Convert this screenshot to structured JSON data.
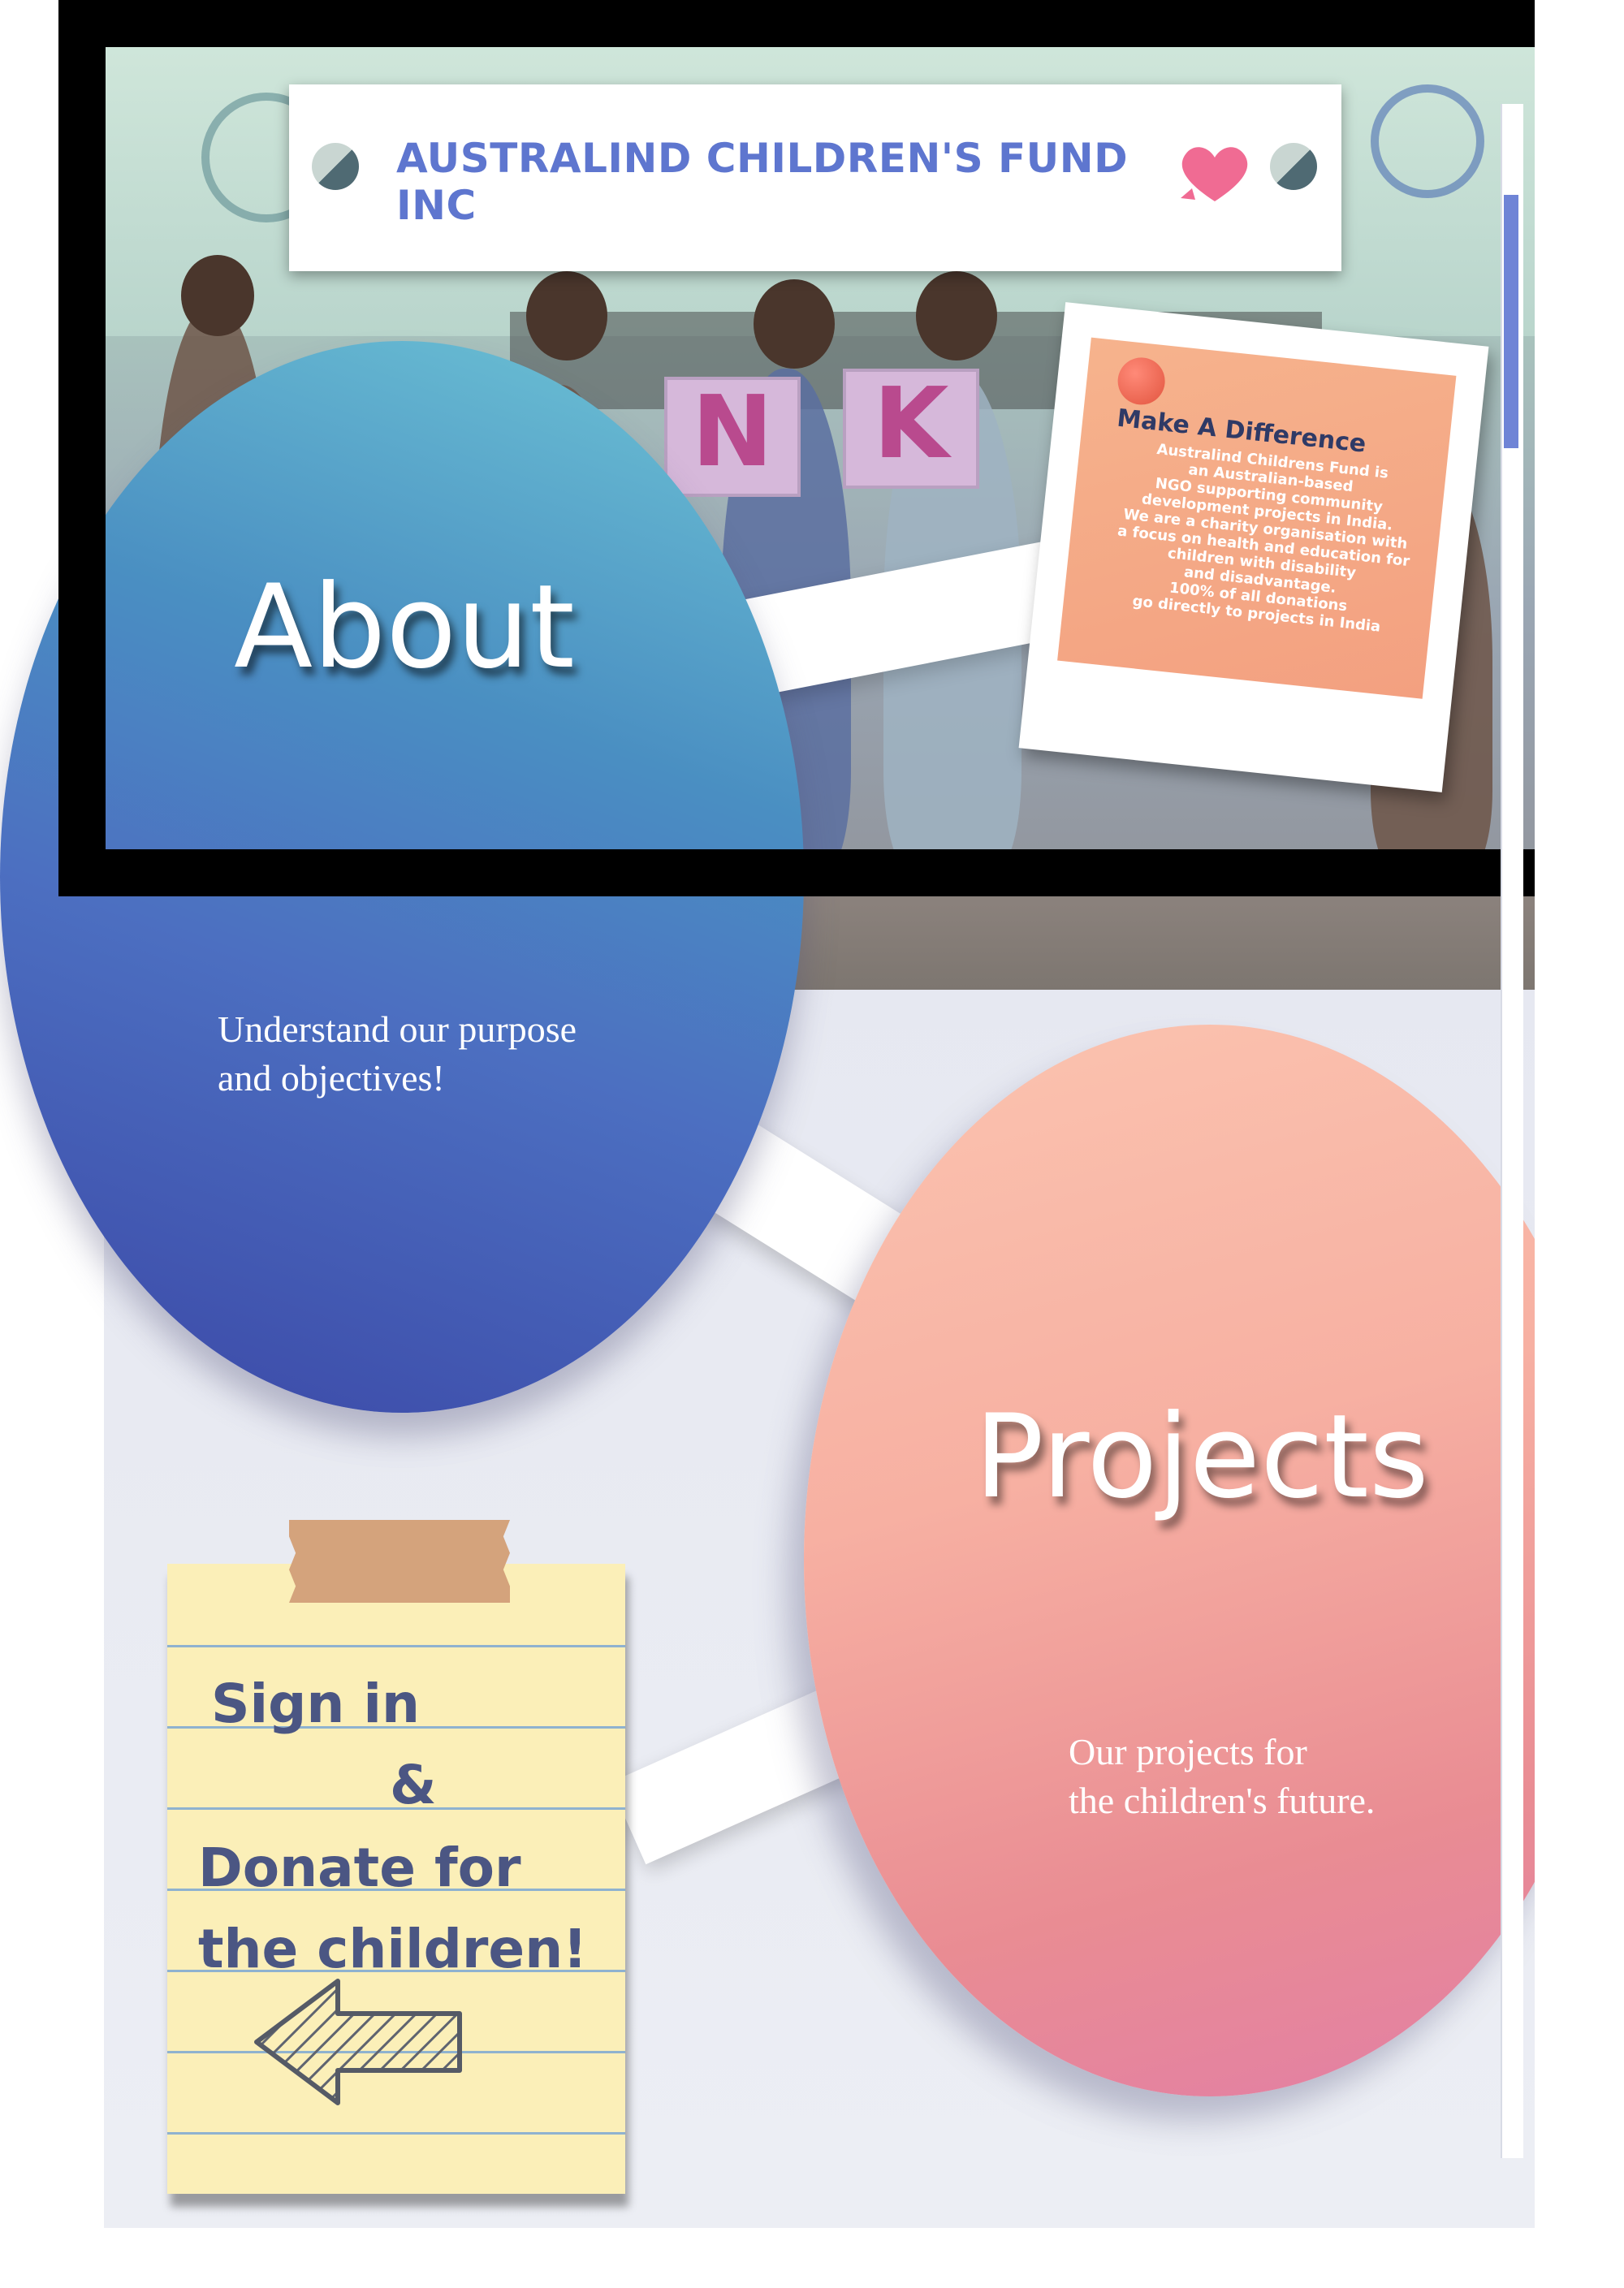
{
  "header": {
    "title": "AUSTRALIND CHILDREN'S FUND INC",
    "left_icon": "globe-ball-icon",
    "right_icons": [
      "heart-icon",
      "globe-ball-icon"
    ]
  },
  "hero": {
    "photo_card_letters": [
      "N",
      "K"
    ]
  },
  "about": {
    "title": "About",
    "subtitle_line1": "Understand our purpose",
    "subtitle_line2": "and objectives!"
  },
  "difference_note": {
    "title": "Make A Difference",
    "lines": [
      "Australind Childrens Fund is",
      "an Australian-based",
      "NGO supporting community",
      "development projects in India.",
      "We are a charity organisation with",
      "a focus on health and education for",
      "children with disability",
      "and disadvantage.",
      "100% of all donations",
      "go directly to projects in India"
    ]
  },
  "projects": {
    "title": "Projects",
    "subtitle_line1": "Our projects for",
    "subtitle_line2": "the children's future."
  },
  "signin_note": {
    "line1": "Sign in",
    "line2": "&",
    "line3": "Donate for",
    "line4": "the children!",
    "icon": "arrow-left-icon"
  },
  "colors": {
    "brand_blue": "#5e76cf",
    "about_circle": "#4a8fc2",
    "projects_circle": "#f7b0a2",
    "note_orange": "#f6b38d",
    "sticky_yellow": "#fbefb8",
    "frame": "#000000"
  }
}
